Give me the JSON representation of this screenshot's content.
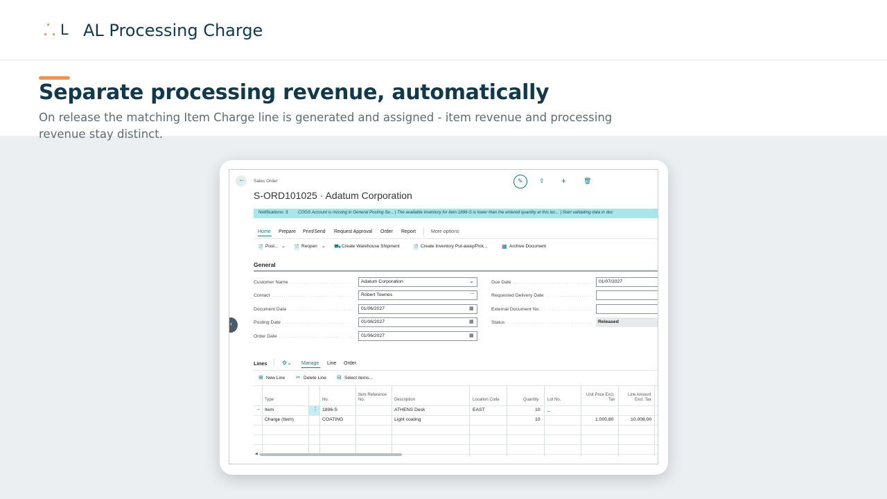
{
  "header": {
    "app_title": "AL Processing Charge"
  },
  "hero": {
    "headline": "Separate processing revenue, automatically",
    "subline": "On release the matching Item Charge line is generated and assigned - item revenue and processing revenue stay distinct."
  },
  "order": {
    "breadcrumb": "Sales Order",
    "title": "S-ORD101025 · Adatum Corporation",
    "notifications_label": "Notifications: 3",
    "notifications_text": "COGS Account is missing in General Posting Se...  |  The available inventory for item 1896-S is lower than the entered quantity at this loc...  |  Start validating data in doc",
    "menu_tabs": [
      "Home",
      "Prepare",
      "Print/Send",
      "Request Approval",
      "Order",
      "Report"
    ],
    "more_options": "More options",
    "actions": {
      "post": "Post...",
      "reopen": "Reopen",
      "create_warehouse_shipment": "Create Warehouse Shipment",
      "create_inventory_putaway": "Create Inventory Put-away/Pick...",
      "archive_document": "Archive Document"
    },
    "general_title": "General",
    "fields_left": [
      {
        "label": "Customer Name",
        "value": "Adatum Corporation"
      },
      {
        "label": "Contact",
        "value": "Robert Townes"
      },
      {
        "label": "Document Date",
        "value": "01/06/2027"
      },
      {
        "label": "Posting Date",
        "value": "01/06/2027"
      },
      {
        "label": "Order Date",
        "value": "01/06/2027"
      }
    ],
    "fields_right": [
      {
        "label": "Due Date",
        "value": "01/07/2027"
      },
      {
        "label": "Requested Delivery Date",
        "value": ""
      },
      {
        "label": "External Document No.",
        "value": ""
      },
      {
        "label": "Status",
        "value": "Released"
      }
    ]
  },
  "lines": {
    "title": "Lines",
    "tabs": [
      "Manage",
      "Line",
      "Order"
    ],
    "actions": {
      "new_line": "New Line",
      "delete_line": "Delete Line",
      "select_items": "Select items..."
    },
    "columns": {
      "type": "Type",
      "no": "No.",
      "item_ref_1": "Item Reference",
      "item_ref_2": "No.",
      "description": "Description",
      "location": "Location Code",
      "quantity": "Quantity",
      "lot": "Lot No.",
      "unit_price_1": "Unit Price Excl.",
      "unit_price_2": "Tax",
      "line_amount_1": "Line Amount",
      "line_amount_2": "Excl. Tax"
    },
    "rows": [
      {
        "type": "Item",
        "no": "1896-S",
        "description": "ATHENS Desk",
        "location": "EAST",
        "quantity": "10",
        "lot": "_",
        "unit_price": "",
        "line_amount": ""
      },
      {
        "type": "Charge (Item)",
        "no": "COATING",
        "description": "Light coating",
        "location": "",
        "quantity": "10",
        "lot": "",
        "unit_price": "1.000,80",
        "line_amount": "10.008,00"
      }
    ]
  },
  "colors": {
    "brand": "#12394a",
    "accent": "#ef9350",
    "teal": "#0f7c82",
    "notification_bg": "#a8e6ea"
  }
}
